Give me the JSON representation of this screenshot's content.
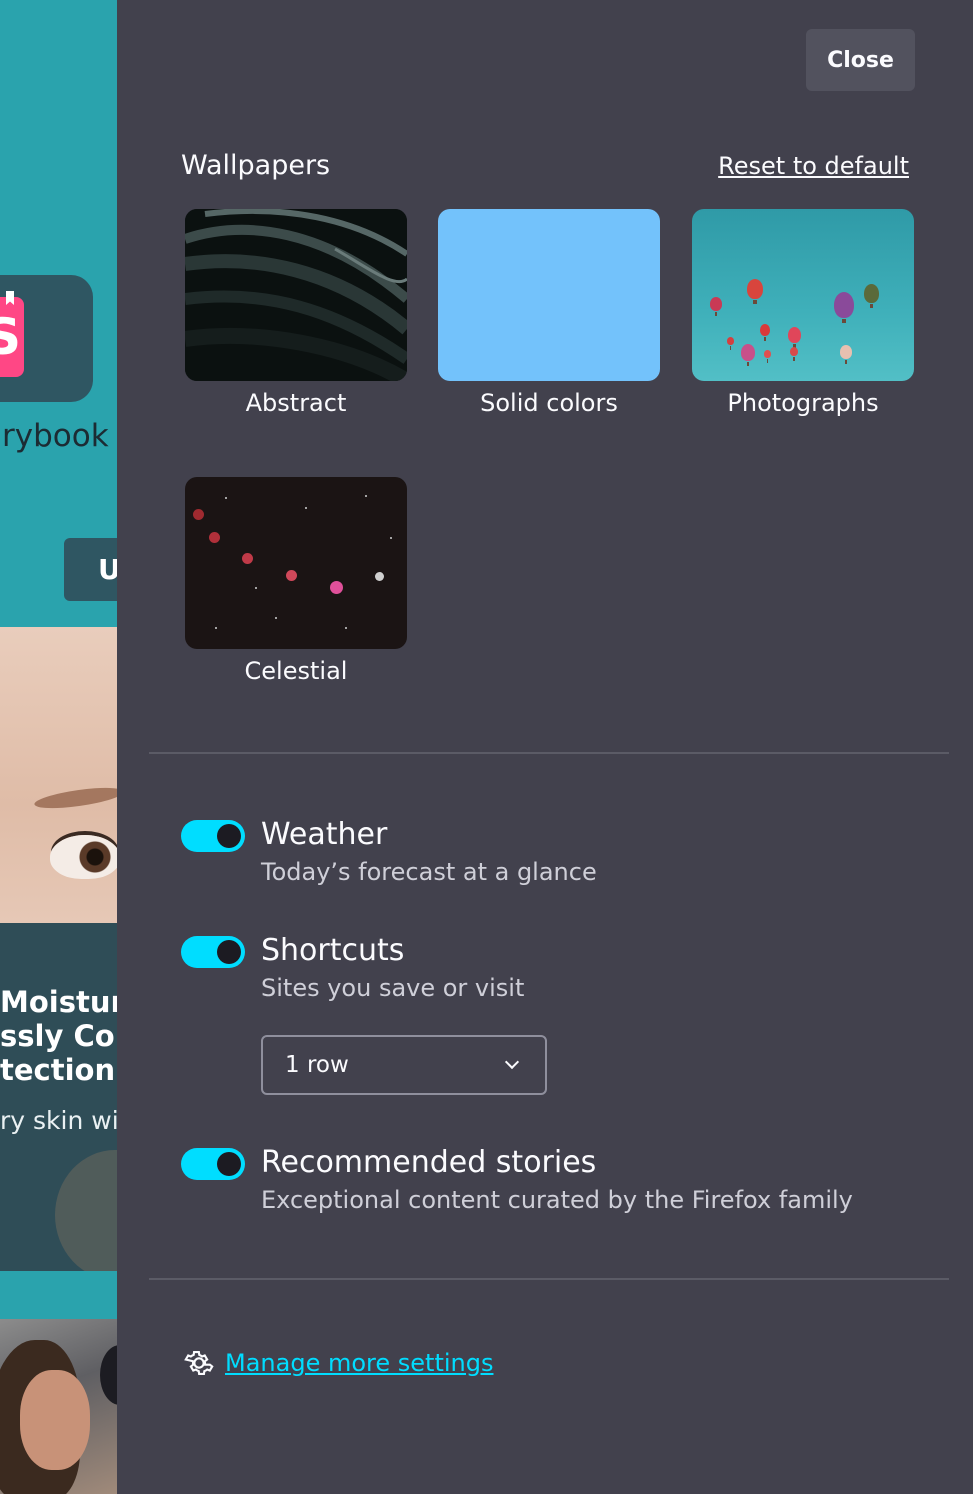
{
  "background": {
    "brand_fragment": "rybook",
    "button_fragment": "U",
    "article_title_lines": [
      "Moisturi",
      "ssly Com",
      "tection"
    ],
    "article_desc_fragment": "ry skin wit"
  },
  "panel": {
    "close_label": "Close",
    "wallpapers": {
      "title": "Wallpapers",
      "reset_label": "Reset to default",
      "items": [
        {
          "label": "Abstract"
        },
        {
          "label": "Solid colors",
          "color": "#73c2fb"
        },
        {
          "label": "Photographs"
        },
        {
          "label": "Celestial"
        }
      ]
    },
    "options": [
      {
        "title": "Weather",
        "description": "Today’s forecast at a glance",
        "enabled": true
      },
      {
        "title": "Shortcuts",
        "description": "Sites you save or visit",
        "enabled": true,
        "rows_select": {
          "value": "1 row"
        }
      },
      {
        "title": "Recommended stories",
        "description": "Exceptional content curated by the Firefox family",
        "enabled": true
      }
    ],
    "manage_label": "Manage more settings"
  },
  "colors": {
    "panel_bg": "#42414d",
    "accent": "#00ddff",
    "close_bg": "#52525e"
  },
  "icons": {
    "manage": "gear-icon",
    "select": "chevron-down-icon"
  }
}
